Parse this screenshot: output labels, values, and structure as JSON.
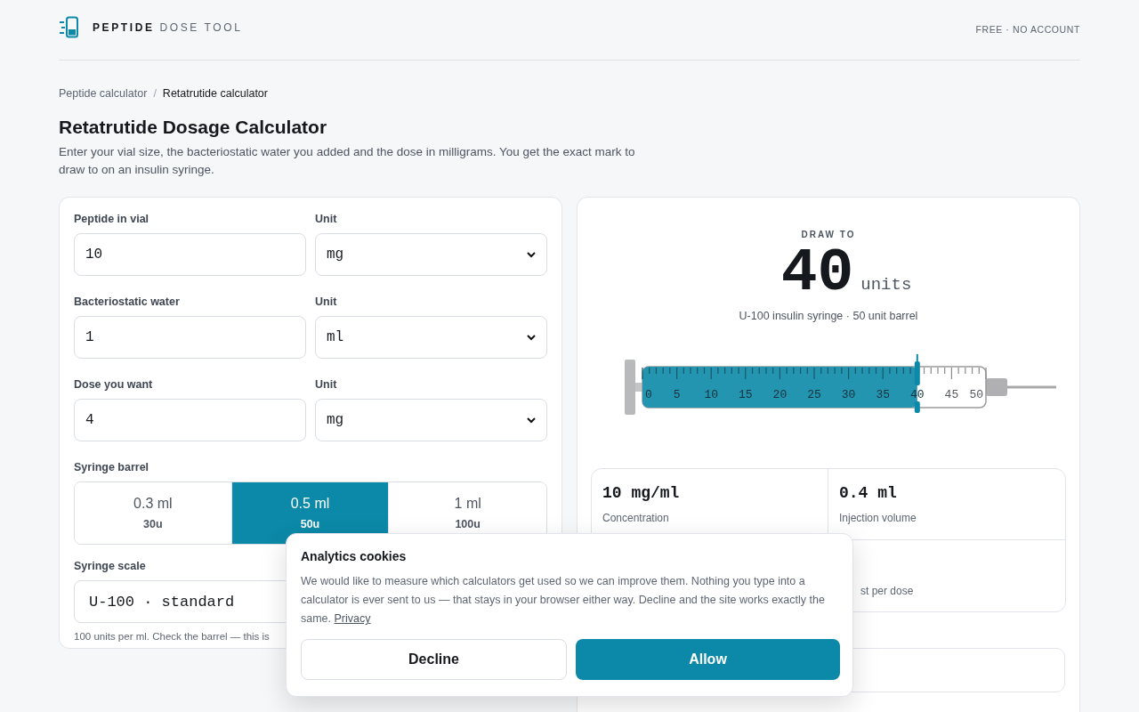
{
  "header": {
    "brand_bold": "PEPTIDE",
    "brand_light": "DOSE TOOL",
    "tagline": "FREE · NO ACCOUNT"
  },
  "breadcrumb": {
    "separator": "/",
    "items": [
      {
        "label": "Peptide calculator",
        "current": false
      },
      {
        "label": "Retatrutide calculator",
        "current": true
      }
    ]
  },
  "title": "Retatrutide Dosage Calculator",
  "intro": "Enter your vial size, the bacteriostatic water you added and the dose in milligrams. You get the exact mark to draw to on an insulin syringe.",
  "form": {
    "fields": [
      {
        "label": "Peptide in vial",
        "value": "10",
        "unit_label": "Unit",
        "unit": "mg"
      },
      {
        "label": "Bacteriostatic water",
        "value": "1",
        "unit_label": "Unit",
        "unit": "ml"
      },
      {
        "label": "Dose you want",
        "value": "4",
        "unit_label": "Unit",
        "unit": "mg"
      }
    ],
    "barrel": {
      "label": "Syringe barrel",
      "options": [
        {
          "size": "0.3 ml",
          "units": "30u",
          "selected": false
        },
        {
          "size": "0.5 ml",
          "units": "50u",
          "selected": true
        },
        {
          "size": "1 ml",
          "units": "100u",
          "selected": false
        }
      ]
    },
    "scale": {
      "label": "Syringe scale",
      "value": "U-100 · standard",
      "hint": "100 units per ml. Check the barrel — this is"
    }
  },
  "result": {
    "eyebrow": "DRAW TO",
    "value": "40",
    "unit": "units",
    "caption": "U-100 insulin syringe · 50 unit barrel",
    "syringe": {
      "level": 0.8,
      "scale_labels": [
        "0",
        "5",
        "10",
        "15",
        "20",
        "25",
        "30",
        "35",
        "40",
        "45",
        "50"
      ]
    },
    "stats": [
      {
        "value": "10 mg/ml",
        "label": "Concentration"
      },
      {
        "value": "0.4 ml",
        "label": "Injection volume"
      },
      {
        "label": "st per dose"
      }
    ]
  },
  "cookie": {
    "title": "Analytics cookies",
    "text": "We would like to measure which calculators get used so we can improve them. Nothing you type into a calculator is ever sent to us — that stays in your browser either way. Decline and the site works exactly the same.",
    "link": "Privacy",
    "decline": "Decline",
    "allow": "Allow"
  }
}
